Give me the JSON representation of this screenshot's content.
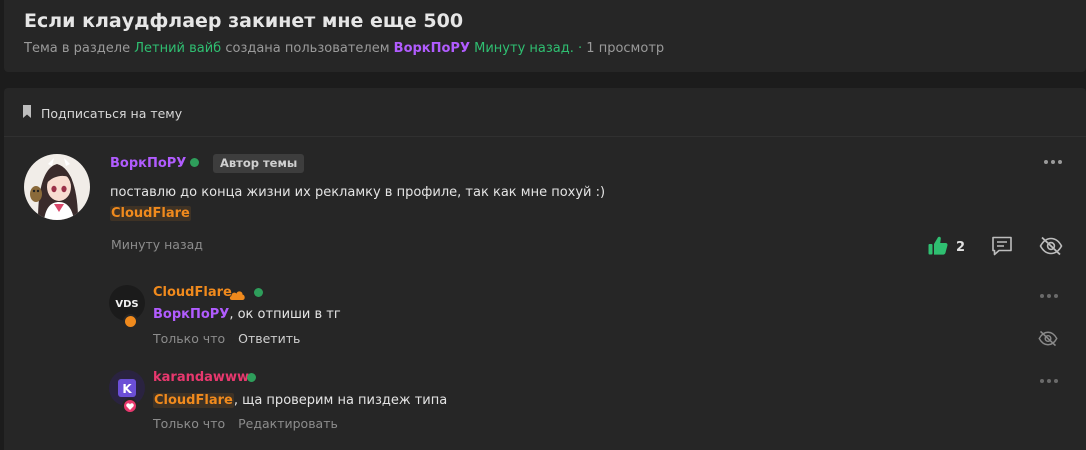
{
  "thread": {
    "title": "Если клаудфлаер закинет мне еще 500",
    "meta_prefix": "Тема в разделе",
    "section": "Летний вайб",
    "meta_created": "создана пользователем",
    "author": "ВоркПоРУ",
    "time": "Минуту назад.",
    "views_sep": "·",
    "views": "1 просмотр"
  },
  "subscribe": {
    "label": "Подписаться на тему"
  },
  "post": {
    "author": "ВоркПоРУ",
    "badge": "Автор темы",
    "text": "поставлю до конца жизни их рекламку в профиле, так как мне похуй :)",
    "mention": "CloudFlare",
    "time": "Минуту назад",
    "likes": "2"
  },
  "replies": [
    {
      "author": "CloudFlare",
      "author_color": "#f08a1d",
      "mention": "ВоркПоРУ",
      "text": ", ок отпиши в тг",
      "time": "Только что",
      "action": "Ответить"
    },
    {
      "author": "karandawww",
      "author_color": "#e8386e",
      "mention": "CloudFlare",
      "text": ", ща проверим на пиздеж типа",
      "time": "Только что",
      "action": "Редактировать"
    }
  ],
  "colors": {
    "background": "#1c1c1c",
    "card": "#262626",
    "green": "#2fbf71",
    "purple": "#b15cff",
    "orange": "#f08a1d",
    "pink": "#e8386e"
  },
  "icons": {
    "subscribe": "bookmark-icon",
    "like": "thumbs-up-icon",
    "comment": "comment-icon",
    "hide": "eye-slash-icon",
    "more": "more-dots-icon",
    "cloud": "cloud-icon"
  }
}
